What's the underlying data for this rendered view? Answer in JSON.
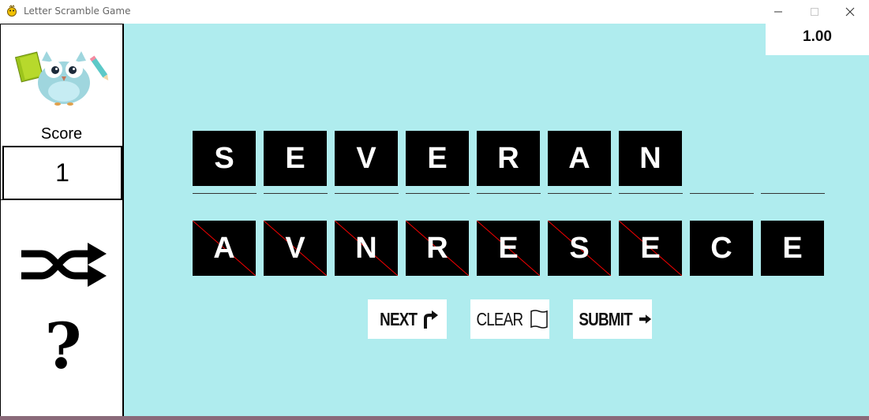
{
  "window": {
    "title": "Letter Scramble Game",
    "minimize_icon": "minimize-icon",
    "maximize_icon": "maximize-icon",
    "close_icon": "close-icon"
  },
  "sidebar": {
    "mascot": "owl-mascot",
    "score_label": "Score",
    "score_value": "1",
    "shuffle_icon": "shuffle-icon",
    "help_icon": "question-mark-icon"
  },
  "timer": {
    "value": "1.00"
  },
  "answer_letters": [
    "S",
    "E",
    "V",
    "E",
    "R",
    "A",
    "N"
  ],
  "answer_slot_count": 9,
  "scrambled_tiles": [
    {
      "letter": "A",
      "used": true
    },
    {
      "letter": "V",
      "used": true
    },
    {
      "letter": "N",
      "used": true
    },
    {
      "letter": "R",
      "used": true
    },
    {
      "letter": "E",
      "used": true
    },
    {
      "letter": "S",
      "used": true
    },
    {
      "letter": "E",
      "used": true
    },
    {
      "letter": "C",
      "used": false
    },
    {
      "letter": "E",
      "used": false
    }
  ],
  "buttons": {
    "next": {
      "label": "NEXT",
      "icon": "turn-right-arrow-icon"
    },
    "clear": {
      "label": "CLEAR",
      "icon": "eraser-icon"
    },
    "submit": {
      "label": "SUBMIT",
      "icon": "right-arrow-icon"
    }
  },
  "colors": {
    "game_background": "#afecee",
    "tile": "#000000",
    "tile_text": "#ffffff",
    "used_cross": "#ff0000"
  }
}
